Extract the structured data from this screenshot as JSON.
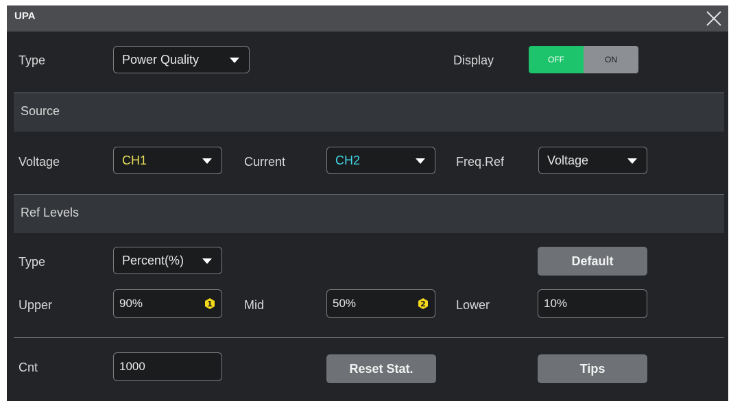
{
  "window": {
    "title": "UPA"
  },
  "top": {
    "type_label": "Type",
    "type_value": "Power Quality",
    "display_label": "Display",
    "display_off": "OFF",
    "display_on": "ON",
    "display_state": "OFF"
  },
  "source": {
    "header": "Source",
    "voltage_label": "Voltage",
    "voltage_value": "CH1",
    "current_label": "Current",
    "current_value": "CH2",
    "freqref_label": "Freq.Ref",
    "freqref_value": "Voltage"
  },
  "ref_levels": {
    "header": "Ref Levels",
    "type_label": "Type",
    "type_value": "Percent(%)",
    "default_button": "Default",
    "upper_label": "Upper",
    "upper_value": "90%",
    "mid_label": "Mid",
    "mid_value": "50%",
    "lower_label": "Lower",
    "lower_value": "10%"
  },
  "stats": {
    "cnt_label": "Cnt",
    "cnt_value": "1000",
    "reset_button": "Reset Stat.",
    "tips_button": "Tips"
  },
  "colors": {
    "ch1": "#e8e05a",
    "ch2": "#3fd6e6",
    "toggle_on_green": "#1ec46b",
    "badge_yellow": "#f3d81b"
  }
}
